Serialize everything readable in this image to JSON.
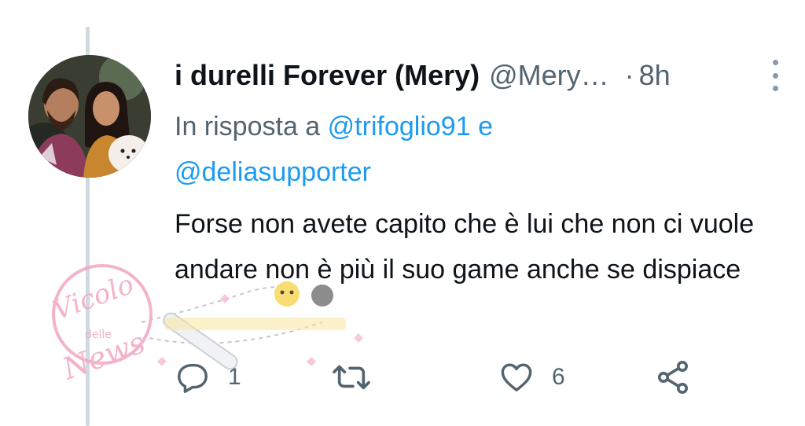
{
  "tweet": {
    "display_name": "i durelli Forever (Mery)",
    "handle": "@Mery…",
    "separator": "·",
    "time": "8h",
    "reply_prefix": "In risposta a",
    "mentions": [
      "@trifoglio91",
      "@deliasupporter"
    ],
    "conjunction": "e",
    "text": "Forse non avete capito che è lui che non ci vuole andare non è più il suo game anche se dispiace"
  },
  "actions": {
    "reply": {
      "icon": "reply-icon",
      "count": "1"
    },
    "retweet": {
      "icon": "retweet-icon",
      "count": ""
    },
    "like": {
      "icon": "heart-icon",
      "count": "6"
    },
    "share": {
      "icon": "share-icon",
      "count": ""
    }
  },
  "watermark": {
    "line1": "Vicolo",
    "line2": "delle",
    "line3": "News"
  },
  "colors": {
    "text": "#0f1419",
    "secondary": "#536471",
    "accent": "#1d9bf0",
    "thread_line": "#cfd9de",
    "watermark": "#f2a6c2"
  }
}
